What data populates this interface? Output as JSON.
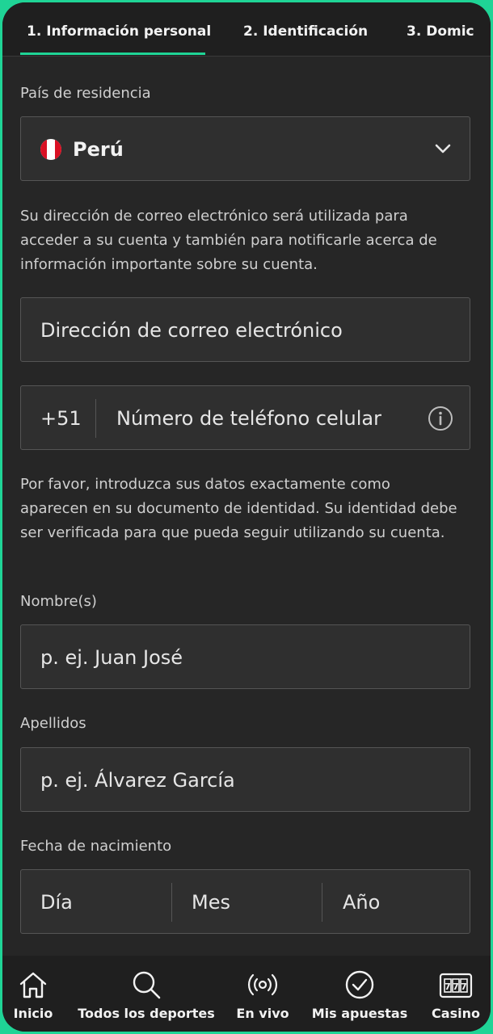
{
  "tabs": [
    {
      "label": "1. Información personal"
    },
    {
      "label": "2. Identificación"
    },
    {
      "label": "3. Domic"
    }
  ],
  "country": {
    "label": "País de residencia",
    "value": "Perú",
    "flag_icon": "peru-flag-icon"
  },
  "email": {
    "note": "Su dirección de correo electrónico será utilizada para acceder a su cuenta y también para notificarle acerca de información importante sobre su cuenta.",
    "placeholder": "Dirección de correo electrónico"
  },
  "phone": {
    "prefix": "+51",
    "placeholder": "Número de teléfono celular",
    "info_icon": "info-icon"
  },
  "identity_note": "Por favor, introduzca sus datos exactamente como aparecen en su documento de identidad. Su identidad debe ser verificada para que pueda seguir utilizando su cuenta.",
  "first_name": {
    "label": "Nombre(s)",
    "placeholder": "p. ej. Juan José"
  },
  "last_name": {
    "label": "Apellidos",
    "placeholder": "p. ej. Álvarez García"
  },
  "birth_date": {
    "label": "Fecha de nacimiento",
    "day": "Día",
    "month": "Mes",
    "year": "Año"
  },
  "bottom_nav": [
    {
      "label": "Inicio",
      "icon": "home-icon"
    },
    {
      "label": "Todos los deportes",
      "icon": "search-icon"
    },
    {
      "label": "En vivo",
      "icon": "live-broadcast-icon"
    },
    {
      "label": "Mis apuestas",
      "icon": "check-circle-icon"
    },
    {
      "label": "Casino",
      "icon": "slot-machine-icon"
    }
  ],
  "colors": {
    "accent": "#1fd496",
    "background": "#262626",
    "field": "#2f2f2f"
  }
}
